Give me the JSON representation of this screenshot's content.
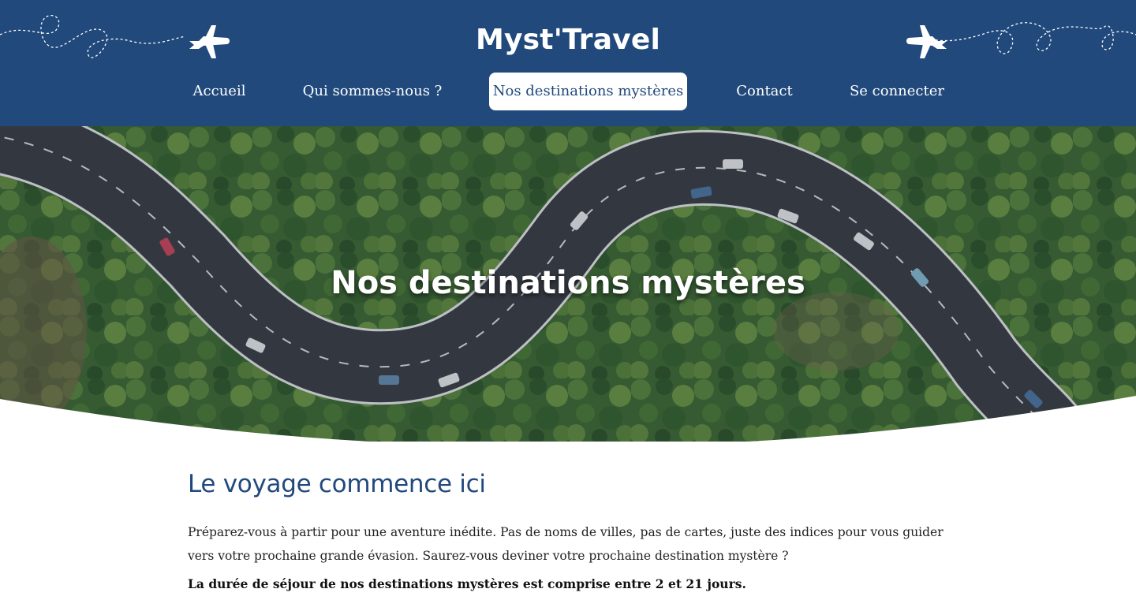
{
  "header": {
    "brand": "Myst'Travel",
    "background_color": "#21497c",
    "icons": [
      "plane-icon",
      "flight-trail"
    ]
  },
  "nav": {
    "items": [
      {
        "label": "Accueil",
        "active": false
      },
      {
        "label": "Qui sommes-nous ?",
        "active": false
      },
      {
        "label": "Nos destinations mystères",
        "active": true
      },
      {
        "label": "Contact",
        "active": false
      },
      {
        "label": "Se connecter",
        "active": false
      }
    ]
  },
  "hero": {
    "title": "Nos destinations mystères"
  },
  "content": {
    "heading": "Le voyage commence ici",
    "intro": "Préparez-vous à partir pour une aventure inédite. Pas de noms de villes, pas de cartes, juste des indices pour vous guider vers votre prochaine grande évasion. Saurez-vous deviner votre prochaine destination mystère ?",
    "note": "La durée de séjour de nos destinations mystères est comprise entre 2 et 21 jours.",
    "heading_color": "#21497c"
  }
}
